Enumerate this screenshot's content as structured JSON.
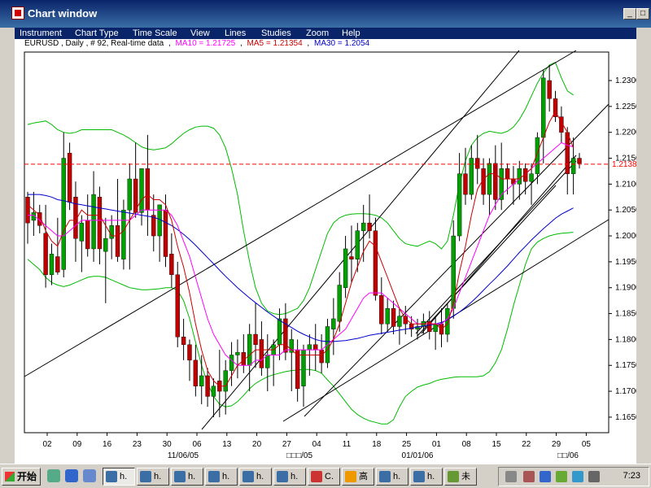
{
  "window": {
    "title": "Chart window",
    "controls": [
      "_",
      "□",
      "×"
    ]
  },
  "menu": [
    "Instrument",
    "Chart Type",
    "Time Scale",
    "View",
    "Lines",
    "Studies",
    "Zoom",
    "Help"
  ],
  "chart_data": {
    "type": "candlestick",
    "header": {
      "symbol_info": "EURUSD , Daily , # 92, Real-time data",
      "ma10_label": "MA10 = 1.21725",
      "ma5_label": "MA5 = 1.21354",
      "ma30_label": "MA30 = 1.2054"
    },
    "price_marker": {
      "value": 1.21385,
      "label": "1.21385",
      "color": "#ff0000"
    },
    "ylim": [
      1.162,
      1.2355
    ],
    "yticks": [
      1.165,
      1.17,
      1.175,
      1.18,
      1.185,
      1.19,
      1.195,
      1.2,
      1.205,
      1.21,
      1.215,
      1.22,
      1.225,
      1.23
    ],
    "ytick_labels": [
      "1.1650",
      "1.1700",
      "1.1750",
      "1.1800",
      "1.1850",
      "1.1900",
      "1.1950",
      "1.2000",
      "1.2050",
      "1.2100",
      "1.2150",
      "1.2200",
      "1.2250",
      "1.2300"
    ],
    "x_day_labels": [
      "02",
      "09",
      "16",
      "23",
      "30",
      "06",
      "13",
      "20",
      "27",
      "04",
      "11",
      "18",
      "25",
      "01",
      "08",
      "15",
      "22",
      "29",
      "05"
    ],
    "x_month_labels": [
      "11/06/05",
      "□□□/05",
      "01/01/06",
      "□□/06"
    ],
    "colors": {
      "up": "#00a000",
      "down": "#c00000",
      "ma5": "#cc0000",
      "ma10": "#ff00ff",
      "ma30": "#0000cc",
      "bollinger": "#00bb00",
      "trendline": "#000000",
      "grid": "#000000"
    },
    "candles": [
      {
        "o": 1.2075,
        "h": 1.2085,
        "l": 1.1985,
        "c": 1.2025
      },
      {
        "o": 1.203,
        "h": 1.2085,
        "l": 1.2,
        "c": 1.2045
      },
      {
        "o": 1.2045,
        "h": 1.206,
        "l": 1.2005,
        "c": 1.202
      },
      {
        "o": 1.2005,
        "h": 1.206,
        "l": 1.19,
        "c": 1.1925
      },
      {
        "o": 1.1925,
        "h": 1.1985,
        "l": 1.1905,
        "c": 1.1965
      },
      {
        "o": 1.196,
        "h": 1.2035,
        "l": 1.1925,
        "c": 1.193
      },
      {
        "o": 1.1935,
        "h": 1.22,
        "l": 1.192,
        "c": 1.215
      },
      {
        "o": 1.216,
        "h": 1.218,
        "l": 1.205,
        "c": 1.2065
      },
      {
        "o": 1.2075,
        "h": 1.2105,
        "l": 1.195,
        "c": 1.1995
      },
      {
        "o": 1.199,
        "h": 1.204,
        "l": 1.193,
        "c": 1.2025
      },
      {
        "o": 1.203,
        "h": 1.208,
        "l": 1.196,
        "c": 1.1975
      },
      {
        "o": 1.1975,
        "h": 1.2125,
        "l": 1.195,
        "c": 1.208
      },
      {
        "o": 1.2075,
        "h": 1.2095,
        "l": 1.1945,
        "c": 1.1975
      },
      {
        "o": 1.197,
        "h": 1.2035,
        "l": 1.187,
        "c": 1.1995
      },
      {
        "o": 1.1995,
        "h": 1.204,
        "l": 1.1955,
        "c": 1.202
      },
      {
        "o": 1.202,
        "h": 1.211,
        "l": 1.195,
        "c": 1.196
      },
      {
        "o": 1.1955,
        "h": 1.207,
        "l": 1.1935,
        "c": 1.205
      },
      {
        "o": 1.205,
        "h": 1.214,
        "l": 1.1935,
        "c": 1.211
      },
      {
        "o": 1.211,
        "h": 1.218,
        "l": 1.2035,
        "c": 1.2045
      },
      {
        "o": 1.2045,
        "h": 1.2115,
        "l": 1.202,
        "c": 1.213
      },
      {
        "o": 1.213,
        "h": 1.2195,
        "l": 1.2,
        "c": 1.205
      },
      {
        "o": 1.204,
        "h": 1.208,
        "l": 1.197,
        "c": 1.2
      },
      {
        "o": 1.2,
        "h": 1.203,
        "l": 1.195,
        "c": 1.206
      },
      {
        "o": 1.205,
        "h": 1.208,
        "l": 1.194,
        "c": 1.196
      },
      {
        "o": 1.1965,
        "h": 1.2005,
        "l": 1.19,
        "c": 1.1925
      },
      {
        "o": 1.1925,
        "h": 1.195,
        "l": 1.1785,
        "c": 1.1805
      },
      {
        "o": 1.1805,
        "h": 1.184,
        "l": 1.176,
        "c": 1.179
      },
      {
        "o": 1.179,
        "h": 1.18,
        "l": 1.172,
        "c": 1.176
      },
      {
        "o": 1.176,
        "h": 1.179,
        "l": 1.169,
        "c": 1.171
      },
      {
        "o": 1.171,
        "h": 1.177,
        "l": 1.1675,
        "c": 1.173
      },
      {
        "o": 1.173,
        "h": 1.1745,
        "l": 1.167,
        "c": 1.169
      },
      {
        "o": 1.169,
        "h": 1.1725,
        "l": 1.165,
        "c": 1.171
      },
      {
        "o": 1.172,
        "h": 1.178,
        "l": 1.165,
        "c": 1.17
      },
      {
        "o": 1.17,
        "h": 1.176,
        "l": 1.1655,
        "c": 1.174
      },
      {
        "o": 1.174,
        "h": 1.1795,
        "l": 1.171,
        "c": 1.177
      },
      {
        "o": 1.177,
        "h": 1.18,
        "l": 1.1725,
        "c": 1.1775
      },
      {
        "o": 1.1775,
        "h": 1.181,
        "l": 1.1735,
        "c": 1.175
      },
      {
        "o": 1.175,
        "h": 1.183,
        "l": 1.17,
        "c": 1.181
      },
      {
        "o": 1.181,
        "h": 1.187,
        "l": 1.1745,
        "c": 1.179
      },
      {
        "o": 1.18,
        "h": 1.1835,
        "l": 1.173,
        "c": 1.1745
      },
      {
        "o": 1.1745,
        "h": 1.181,
        "l": 1.17,
        "c": 1.177
      },
      {
        "o": 1.177,
        "h": 1.18,
        "l": 1.171,
        "c": 1.179
      },
      {
        "o": 1.179,
        "h": 1.186,
        "l": 1.176,
        "c": 1.184
      },
      {
        "o": 1.184,
        "h": 1.187,
        "l": 1.176,
        "c": 1.1775
      },
      {
        "o": 1.1775,
        "h": 1.182,
        "l": 1.17,
        "c": 1.18
      },
      {
        "o": 1.178,
        "h": 1.18,
        "l": 1.168,
        "c": 1.1705
      },
      {
        "o": 1.171,
        "h": 1.179,
        "l": 1.167,
        "c": 1.178
      },
      {
        "o": 1.178,
        "h": 1.181,
        "l": 1.173,
        "c": 1.179
      },
      {
        "o": 1.179,
        "h": 1.183,
        "l": 1.174,
        "c": 1.178
      },
      {
        "o": 1.178,
        "h": 1.181,
        "l": 1.1735,
        "c": 1.1755
      },
      {
        "o": 1.1755,
        "h": 1.184,
        "l": 1.1745,
        "c": 1.1825
      },
      {
        "o": 1.182,
        "h": 1.188,
        "l": 1.177,
        "c": 1.184
      },
      {
        "o": 1.1835,
        "h": 1.193,
        "l": 1.1815,
        "c": 1.1905
      },
      {
        "o": 1.19,
        "h": 1.2,
        "l": 1.188,
        "c": 1.1975
      },
      {
        "o": 1.196,
        "h": 1.202,
        "l": 1.191,
        "c": 1.1955
      },
      {
        "o": 1.1955,
        "h": 1.2025,
        "l": 1.193,
        "c": 1.201
      },
      {
        "o": 1.201,
        "h": 1.206,
        "l": 1.195,
        "c": 1.2025
      },
      {
        "o": 1.2025,
        "h": 1.208,
        "l": 1.1995,
        "c": 1.201
      },
      {
        "o": 1.201,
        "h": 1.2035,
        "l": 1.1875,
        "c": 1.1885
      },
      {
        "o": 1.1885,
        "h": 1.192,
        "l": 1.181,
        "c": 1.183
      },
      {
        "o": 1.183,
        "h": 1.188,
        "l": 1.1815,
        "c": 1.186
      },
      {
        "o": 1.186,
        "h": 1.1875,
        "l": 1.181,
        "c": 1.1825
      },
      {
        "o": 1.1825,
        "h": 1.186,
        "l": 1.179,
        "c": 1.1845
      },
      {
        "o": 1.1845,
        "h": 1.1865,
        "l": 1.181,
        "c": 1.183
      },
      {
        "o": 1.183,
        "h": 1.1845,
        "l": 1.1805,
        "c": 1.182
      },
      {
        "o": 1.182,
        "h": 1.184,
        "l": 1.18,
        "c": 1.1825
      },
      {
        "o": 1.1825,
        "h": 1.185,
        "l": 1.181,
        "c": 1.1835
      },
      {
        "o": 1.1835,
        "h": 1.1855,
        "l": 1.18,
        "c": 1.1815
      },
      {
        "o": 1.1815,
        "h": 1.1845,
        "l": 1.178,
        "c": 1.183
      },
      {
        "o": 1.183,
        "h": 1.186,
        "l": 1.1785,
        "c": 1.181
      },
      {
        "o": 1.181,
        "h": 1.187,
        "l": 1.1795,
        "c": 1.186
      },
      {
        "o": 1.186,
        "h": 1.203,
        "l": 1.184,
        "c": 1.2
      },
      {
        "o": 1.2,
        "h": 1.216,
        "l": 1.199,
        "c": 1.212
      },
      {
        "o": 1.212,
        "h": 1.217,
        "l": 1.206,
        "c": 1.208
      },
      {
        "o": 1.208,
        "h": 1.2175,
        "l": 1.207,
        "c": 1.215
      },
      {
        "o": 1.215,
        "h": 1.2195,
        "l": 1.21,
        "c": 1.213
      },
      {
        "o": 1.213,
        "h": 1.215,
        "l": 1.206,
        "c": 1.208
      },
      {
        "o": 1.208,
        "h": 1.215,
        "l": 1.204,
        "c": 1.214
      },
      {
        "o": 1.214,
        "h": 1.2175,
        "l": 1.205,
        "c": 1.207
      },
      {
        "o": 1.207,
        "h": 1.218,
        "l": 1.205,
        "c": 1.213
      },
      {
        "o": 1.213,
        "h": 1.214,
        "l": 1.208,
        "c": 1.211
      },
      {
        "o": 1.211,
        "h": 1.2135,
        "l": 1.206,
        "c": 1.21
      },
      {
        "o": 1.21,
        "h": 1.2145,
        "l": 1.207,
        "c": 1.213
      },
      {
        "o": 1.213,
        "h": 1.214,
        "l": 1.208,
        "c": 1.2105
      },
      {
        "o": 1.2105,
        "h": 1.214,
        "l": 1.206,
        "c": 1.212
      },
      {
        "o": 1.212,
        "h": 1.22,
        "l": 1.21,
        "c": 1.219
      },
      {
        "o": 1.219,
        "h": 1.232,
        "l": 1.214,
        "c": 1.2305
      },
      {
        "o": 1.23,
        "h": 1.233,
        "l": 1.224,
        "c": 1.2265
      },
      {
        "o": 1.2265,
        "h": 1.228,
        "l": 1.222,
        "c": 1.223
      },
      {
        "o": 1.223,
        "h": 1.225,
        "l": 1.218,
        "c": 1.22
      },
      {
        "o": 1.22,
        "h": 1.221,
        "l": 1.208,
        "c": 1.212
      },
      {
        "o": 1.212,
        "h": 1.219,
        "l": 1.208,
        "c": 1.215
      },
      {
        "o": 1.215,
        "h": 1.216,
        "l": 1.213,
        "c": 1.214
      }
    ],
    "ma5": [
      1.206,
      1.205,
      1.204,
      1.201,
      1.199,
      1.198,
      1.201,
      1.203,
      1.203,
      1.205,
      1.204,
      1.204,
      1.204,
      1.202,
      1.2,
      1.2,
      1.201,
      1.203,
      1.205,
      1.207,
      1.208,
      1.207,
      1.207,
      1.206,
      1.203,
      1.198,
      1.194,
      1.189,
      1.183,
      1.178,
      1.174,
      1.172,
      1.171,
      1.171,
      1.173,
      1.175,
      1.176,
      1.177,
      1.178,
      1.178,
      1.178,
      1.178,
      1.179,
      1.179,
      1.178,
      1.177,
      1.177,
      1.177,
      1.177,
      1.177,
      1.178,
      1.18,
      1.183,
      1.187,
      1.191,
      1.194,
      1.197,
      1.199,
      1.198,
      1.195,
      1.192,
      1.189,
      1.186,
      1.184,
      1.183,
      1.183,
      1.183,
      1.183,
      1.183,
      1.182,
      1.183,
      1.187,
      1.193,
      1.198,
      1.204,
      1.209,
      1.211,
      1.212,
      1.212,
      1.211,
      1.211,
      1.211,
      1.211,
      1.212,
      1.213,
      1.216,
      1.219,
      1.222,
      1.224,
      1.222,
      1.22,
      1.217
    ],
    "ma10": [
      1.204,
      1.204,
      1.203,
      1.202,
      1.201,
      1.2,
      1.2,
      1.201,
      1.202,
      1.203,
      1.203,
      1.203,
      1.203,
      1.203,
      1.203,
      1.203,
      1.203,
      1.203,
      1.204,
      1.205,
      1.205,
      1.205,
      1.205,
      1.205,
      1.204,
      1.202,
      1.199,
      1.196,
      1.192,
      1.188,
      1.184,
      1.181,
      1.179,
      1.177,
      1.176,
      1.175,
      1.175,
      1.175,
      1.176,
      1.176,
      1.177,
      1.177,
      1.177,
      1.178,
      1.178,
      1.178,
      1.178,
      1.178,
      1.178,
      1.178,
      1.179,
      1.18,
      1.181,
      1.182,
      1.184,
      1.186,
      1.188,
      1.189,
      1.189,
      1.189,
      1.188,
      1.187,
      1.186,
      1.185,
      1.184,
      1.183,
      1.183,
      1.183,
      1.183,
      1.183,
      1.184,
      1.186,
      1.189,
      1.192,
      1.195,
      1.198,
      1.201,
      1.204,
      1.206,
      1.208,
      1.209,
      1.21,
      1.211,
      1.212,
      1.213,
      1.214,
      1.215,
      1.216,
      1.217,
      1.218,
      1.2175,
      1.2172
    ],
    "ma30": [
      1.208,
      1.208,
      1.208,
      1.2078,
      1.2075,
      1.207,
      1.2068,
      1.2065,
      1.2062,
      1.206,
      1.2058,
      1.2056,
      1.2054,
      1.2052,
      1.205,
      1.2048,
      1.2046,
      1.2044,
      1.2042,
      1.204,
      1.2038,
      1.2036,
      1.2032,
      1.2026,
      1.202,
      1.2012,
      1.2003,
      1.1993,
      1.1982,
      1.197,
      1.1958,
      1.1946,
      1.1934,
      1.1922,
      1.1911,
      1.19,
      1.189,
      1.188,
      1.1871,
      1.1862,
      1.1853,
      1.1845,
      1.1837,
      1.183,
      1.1823,
      1.1816,
      1.181,
      1.1805,
      1.18,
      1.1797,
      1.1796,
      1.1796,
      1.1797,
      1.1798,
      1.18,
      1.1802,
      1.1805,
      1.1808,
      1.181,
      1.1812,
      1.1814,
      1.1816,
      1.1818,
      1.182,
      1.1822,
      1.1824,
      1.1826,
      1.1828,
      1.183,
      1.1833,
      1.1838,
      1.1845,
      1.1853,
      1.1862,
      1.1872,
      1.1883,
      1.1895,
      1.1907,
      1.1918,
      1.193,
      1.1942,
      1.1955,
      1.1968,
      1.198,
      1.1992,
      1.2003,
      1.2014,
      1.2024,
      1.2034,
      1.2042,
      1.2048,
      1.2054
    ],
    "bb_upper": [
      1.2215,
      1.2218,
      1.222,
      1.2222,
      1.2215,
      1.2205,
      1.22,
      1.2198,
      1.22,
      1.2205,
      1.2205,
      1.2205,
      1.2205,
      1.2205,
      1.2205,
      1.22,
      1.2195,
      1.2188,
      1.218,
      1.2172,
      1.2168,
      1.2166,
      1.2168,
      1.217,
      1.2178,
      1.2188,
      1.2198,
      1.2205,
      1.221,
      1.2212,
      1.2212,
      1.2208,
      1.2195,
      1.217,
      1.213,
      1.208,
      1.201,
      1.195,
      1.19,
      1.187,
      1.1855,
      1.185,
      1.1848,
      1.185,
      1.1855,
      1.186,
      1.1875,
      1.19,
      1.1935,
      1.197,
      1.2005,
      1.2025,
      1.2035,
      1.204,
      1.2042,
      1.2043,
      1.2043,
      1.2042,
      1.204,
      1.2035,
      1.2025,
      1.201,
      1.1995,
      1.1985,
      1.1982,
      1.198,
      1.1985,
      1.199,
      1.1985,
      1.1975,
      1.199,
      1.204,
      1.21,
      1.2145,
      1.2175,
      1.219,
      1.2198,
      1.2202,
      1.22,
      1.2198,
      1.2202,
      1.221,
      1.2225,
      1.2245,
      1.227,
      1.2295,
      1.2315,
      1.233,
      1.2335,
      1.2305,
      1.228,
      1.2272
    ],
    "bb_lower": [
      1.1955,
      1.1945,
      1.1935,
      1.192,
      1.191,
      1.1905,
      1.1902,
      1.1905,
      1.191,
      1.1915,
      1.192,
      1.1922,
      1.1922,
      1.192,
      1.1915,
      1.191,
      1.1905,
      1.19,
      1.1898,
      1.1896,
      1.1896,
      1.1897,
      1.1898,
      1.19,
      1.19,
      1.1895,
      1.1875,
      1.184,
      1.1795,
      1.175,
      1.1715,
      1.169,
      1.1675,
      1.167,
      1.1672,
      1.168,
      1.1692,
      1.1705,
      1.1715,
      1.1722,
      1.1728,
      1.1732,
      1.1735,
      1.1738,
      1.174,
      1.1741,
      1.1742,
      1.1742,
      1.174,
      1.1735,
      1.1722,
      1.171,
      1.1695,
      1.168,
      1.1665,
      1.1655,
      1.1648,
      1.1643,
      1.164,
      1.1637,
      1.1637,
      1.1645,
      1.167,
      1.169,
      1.17,
      1.1708,
      1.1712,
      1.1715,
      1.172,
      1.1723,
      1.1725,
      1.1727,
      1.1728,
      1.1728,
      1.1728,
      1.1728,
      1.173,
      1.1738,
      1.1755,
      1.178,
      1.182,
      1.1865,
      1.1905,
      1.1945,
      1.1975,
      1.1988,
      1.1995,
      1.2,
      1.2003,
      1.2005,
      1.2006,
      1.2007
    ]
  }
}
